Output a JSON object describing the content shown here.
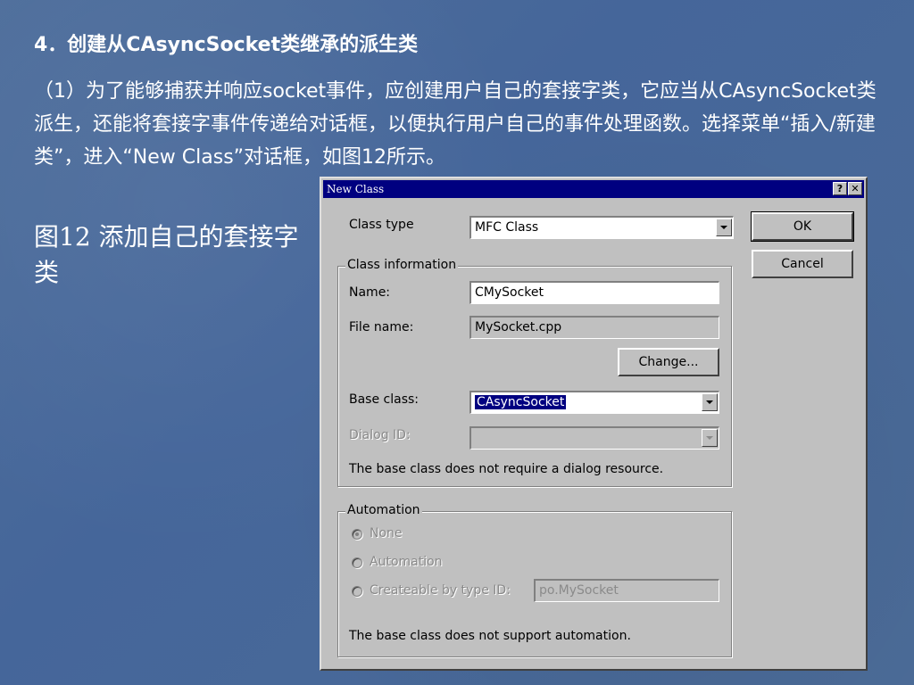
{
  "slide": {
    "heading": "4．创建从CAsyncSocket类继承的派生类",
    "paragraph": "（1）为了能够捕获并响应socket事件，应创建用户自己的套接字类，它应当从CAsyncSocket类派生，还能将套接字事件传递给对话框，以便执行用户自己的事件处理函数。选择菜单“插入/新建类”，进入“New Class”对话框，如图12所示。",
    "caption": "图12 添加自己的套接字类"
  },
  "dialog": {
    "title": "New Class",
    "help_btn": "?",
    "close_btn": "✕",
    "class_type_label": "Class type",
    "class_type_value": "MFC Class",
    "ok_label": "OK",
    "cancel_label": "Cancel",
    "class_info_legend": "Class information",
    "name_label": "Name:",
    "name_value": "CMySocket",
    "file_name_label": "File name:",
    "file_name_value": "MySocket.cpp",
    "change_label": "Change...",
    "base_class_label": "Base class:",
    "base_class_value": "CAsyncSocket",
    "dialog_id_label": "Dialog ID:",
    "dialog_id_value": "",
    "base_note": "The base class does not require a dialog resource.",
    "automation_legend": "Automation",
    "radio_none": "None",
    "radio_automation": "Automation",
    "radio_createable": "Createable by type ID:",
    "type_id_value": "po.MySocket",
    "automation_note": "The base class does not support automation."
  },
  "colors": {
    "slide_bg": "#4a6a96",
    "dialog_bg": "#c0c0c0",
    "titlebar": "#000080"
  }
}
